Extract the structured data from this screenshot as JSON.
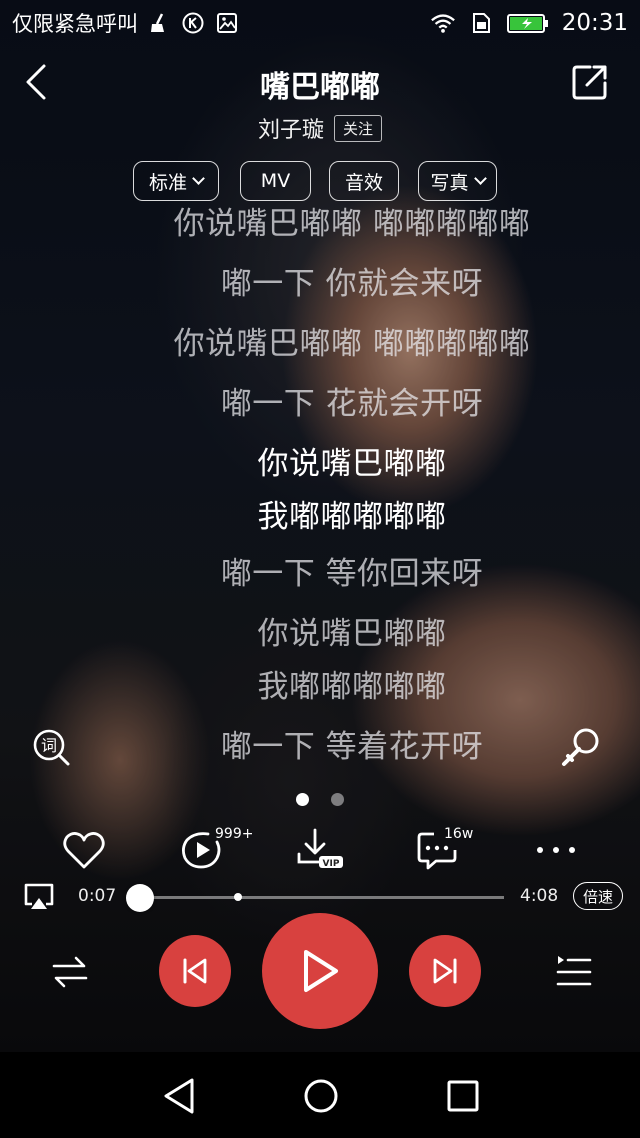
{
  "status_bar": {
    "notification_text": "仅限紧急呼叫",
    "time": "20:31",
    "icons": [
      "broom-icon",
      "k-circle-icon",
      "image-icon",
      "wifi-icon",
      "sim-icon",
      "battery-charging-icon"
    ]
  },
  "header": {
    "title": "嘴巴嘟嘟",
    "artist": "刘子璇",
    "follow_label": "关注"
  },
  "pills": [
    {
      "label": "标准",
      "has_dropdown": true
    },
    {
      "label": "MV",
      "has_dropdown": false
    },
    {
      "label": "音效",
      "has_dropdown": false
    },
    {
      "label": "写真",
      "has_dropdown": true
    }
  ],
  "lyrics": [
    {
      "text": "你说嘴巴嘟嘟 嘟嘟嘟嘟嘟",
      "active": false
    },
    {
      "text": "嘟一下 你就会来呀",
      "active": false
    },
    {
      "text": "你说嘴巴嘟嘟 嘟嘟嘟嘟嘟",
      "active": false
    },
    {
      "text": "嘟一下 花就会开呀",
      "active": false
    },
    {
      "text": "你说嘴巴嘟嘟",
      "active": true
    },
    {
      "text": "我嘟嘟嘟嘟嘟",
      "active": true
    },
    {
      "text": "嘟一下 等你回来呀",
      "active": false
    },
    {
      "text": "你说嘴巴嘟嘟",
      "active": false
    },
    {
      "text": "我嘟嘟嘟嘟嘟",
      "active": false
    },
    {
      "text": "嘟一下 等着花开呀",
      "active": false
    }
  ],
  "lyric_search_label": "词",
  "pager": {
    "count": 2,
    "current": 1
  },
  "actions": {
    "plays_badge": "999+",
    "comments_badge": "16w",
    "download_badge": "VIP"
  },
  "progress": {
    "elapsed": "0:07",
    "duration": "4:08",
    "fraction": 0.028,
    "buffered_fraction": 0.29,
    "speed_label": "倍速"
  },
  "colors": {
    "accent": "#d8413f",
    "progress_played": "#e04848"
  }
}
